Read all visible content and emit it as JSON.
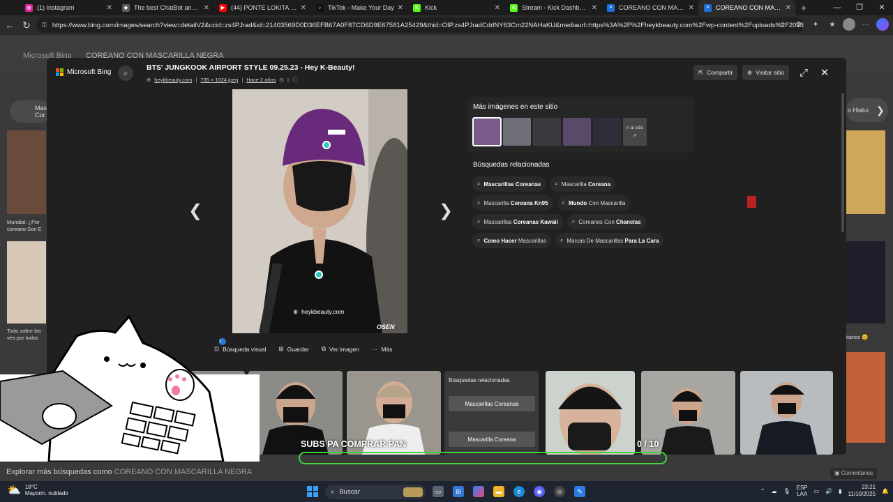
{
  "browser": {
    "tabs": [
      {
        "title": "(1) Instagram",
        "favicon_color": "#d6249f",
        "icon": "instagram-icon",
        "glyph": "◎"
      },
      {
        "title": "The best ChatBot and Widg",
        "favicon_color": "#5a5a5a",
        "icon": "chatbot-icon",
        "glyph": "◆"
      },
      {
        "title": "(44) PONTE LOKITA - Bu",
        "favicon_color": "#ff0000",
        "icon": "youtube-icon",
        "glyph": "▶"
      },
      {
        "title": "TikTok - Make Your Day",
        "favicon_color": "#111111",
        "icon": "tiktok-icon",
        "glyph": "♪"
      },
      {
        "title": "Kick",
        "favicon_color": "#53fc18",
        "icon": "kick-icon",
        "glyph": "K"
      },
      {
        "title": "Stream - Kick Dashboard",
        "favicon_color": "#53fc18",
        "icon": "kick-icon",
        "glyph": "K"
      },
      {
        "title": "COREANO CON MASCARIL",
        "favicon_color": "#1f6fd6",
        "icon": "bing-search-icon",
        "glyph": "⌕"
      },
      {
        "title": "COREANO CON MASCARIL",
        "favicon_color": "#1f6fd6",
        "icon": "bing-search-icon",
        "glyph": "⌕"
      }
    ],
    "url": "https://www.bing.com/images/search?view=detailV2&ccid=zs4PJrad&id=21403569D0D36EFB67A0F87CD6D9E67581A25429&thid=OIP.zs4PJradCdrlNY63Cm22NAHaKU&mediaurl=https%3A%2F%2Fheykbeauty.com%2Fwp-content%2Fuploads%2F2023%..."
  },
  "bg_page": {
    "logo": "Microsoft Bing",
    "query": "COREANO CON MASCARILLA NEGRA",
    "left_cards": [
      {
        "text": "Mundial: ¿Por coreano Son E"
      },
      {
        "text": "Todo sobre las ves por todas"
      }
    ],
    "right_cards": [
      {
        "text": "o Hialui"
      },
      {
        "text": "itarios 😊"
      }
    ],
    "top_chip_left": {
      "title": "Mas",
      "sub": "Cor"
    }
  },
  "viewer": {
    "brand": "Microsoft Bing",
    "title": "BTS' JUNGKOOK AIRPORT STYLE 09.25.23 - Hey K-Beauty!",
    "meta": {
      "site": "heykbeauty.com",
      "size": "735 × 1024 jpeg",
      "age": "Hace 2 años"
    },
    "share_label": "Compartir",
    "visit_label": "Visitar sitio",
    "source_pill": "heykbeauty.com",
    "watermark": "OSEN",
    "more_images_title": "Más imágenes en este sitio",
    "go_to_site": "Ir al sitio",
    "related_title": "Búsquedas relacionadas",
    "related_searches": [
      [
        {
          "pre": "",
          "bold": "Mascarillas Coreanas",
          "post": ""
        },
        {
          "pre": "Mascarilla ",
          "bold": "Coreana",
          "post": ""
        }
      ],
      [
        {
          "pre": "Mascarilla ",
          "bold": "Coreana Kn95",
          "post": ""
        },
        {
          "pre": "",
          "bold": "Mundo",
          "post": " Con Mascarilla"
        }
      ],
      [
        {
          "pre": "Mascarillas ",
          "bold": "Coreanas Kawaii",
          "post": ""
        },
        {
          "pre": "Coreanos Con ",
          "bold": "Chanclas",
          "post": ""
        }
      ],
      [
        {
          "pre": "",
          "bold": "Como Hacer",
          "post": " Mascarillas"
        },
        {
          "pre": "Marcas De Mascarillas ",
          "bold": "Para La Cara",
          "post": ""
        }
      ]
    ],
    "actions": {
      "visual_search": "Búsqueda visual",
      "visual_search_badge": "2",
      "save": "Guardar",
      "view_image": "Ver imagen",
      "more": "Más"
    },
    "filmstrip_related": {
      "title": "Búsquedas relacionadas",
      "chips": [
        "Mascarillas Coreanas",
        "Mascarilla Coreana"
      ]
    }
  },
  "stream_overlay": {
    "subs_text": "SUBS PA COMPRAR PAN",
    "counter": "0 / 10",
    "progress_color": "#3fd43c",
    "progress": 0
  },
  "bottom_bar": {
    "explore_prefix": "Explorar más búsquedas como ",
    "explore_query": "COREANO CON MASCARILLA NEGRA",
    "comments_label": "Comentarios"
  },
  "taskbar": {
    "weather_temp": "18°C",
    "weather_desc": "Mayorm. nublado",
    "search_placeholder": "Buscar",
    "lang_top": "ESP",
    "lang_bottom": "LAA",
    "time": "23:21",
    "date": "11/10/2025"
  }
}
